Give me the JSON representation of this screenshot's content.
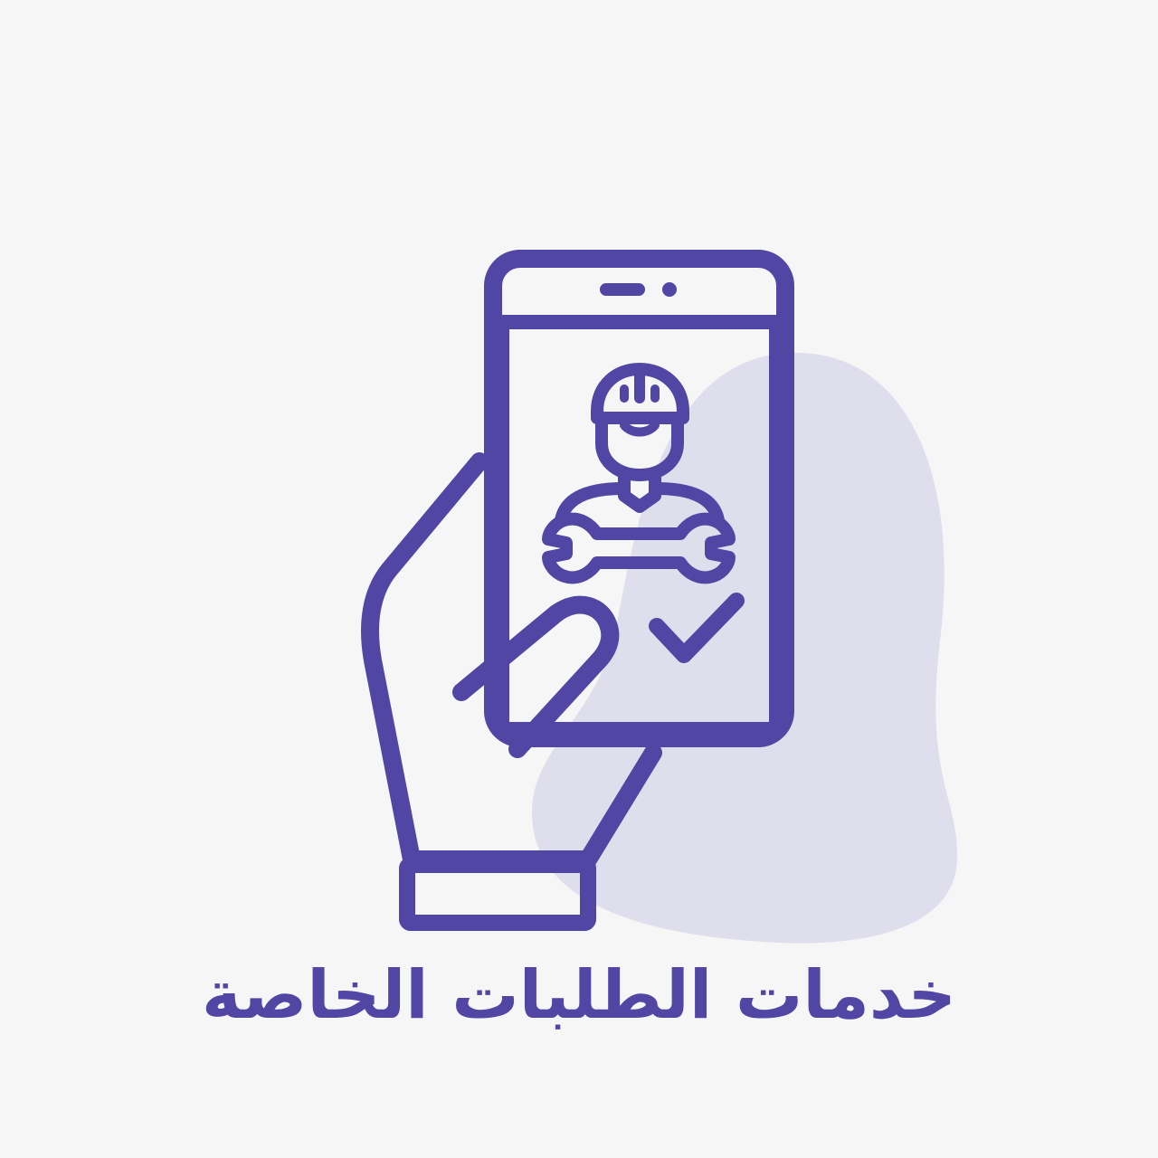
{
  "caption": "خدمات الطلبات الخاصة",
  "colors": {
    "background": "#f6f6f6",
    "primary": "#5146a4",
    "blob": "#dfdeec"
  },
  "icons": {
    "main": "hand-holding-phone-icon",
    "worker": "repair-worker-icon",
    "tool": "wrench-icon",
    "confirm": "checkmark-icon"
  }
}
